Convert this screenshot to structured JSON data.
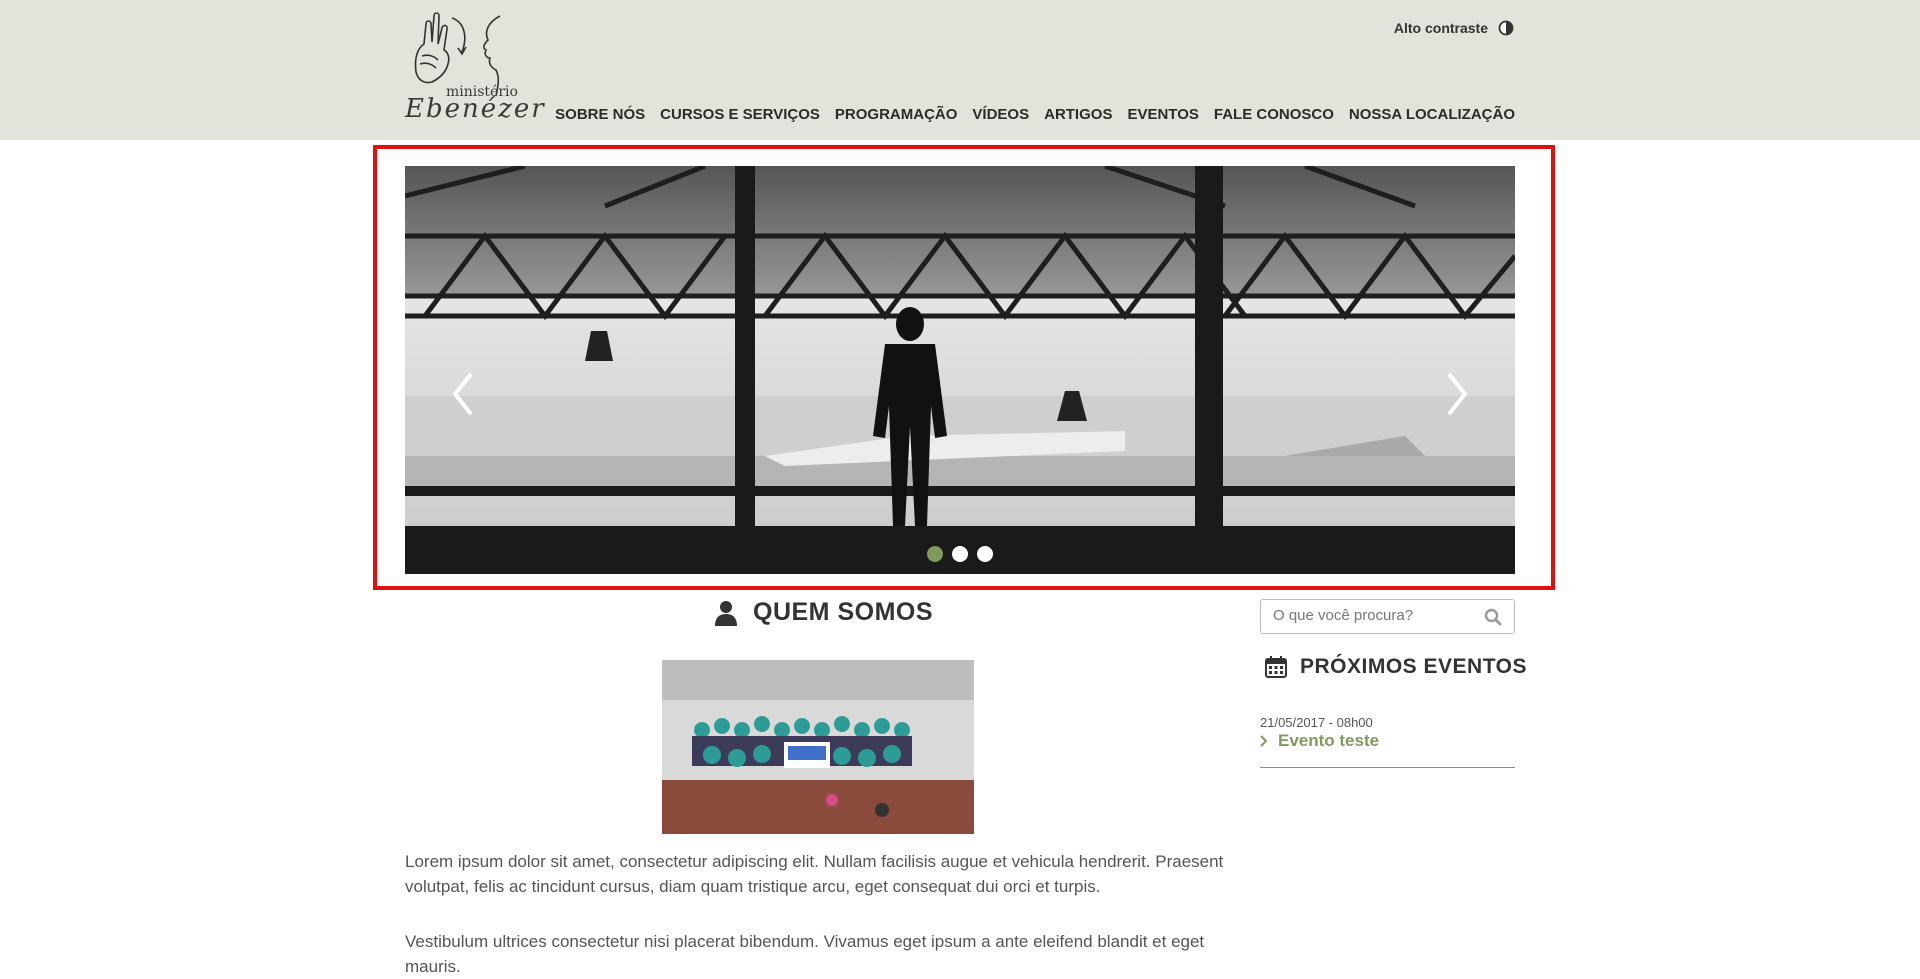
{
  "header": {
    "logo_text_top": "ministério",
    "logo_text_bottom": "Ebenézer",
    "contrast_label": "Alto contraste",
    "nav": [
      "SOBRE NÓS",
      "CURSOS E SERVIÇOS",
      "PROGRAMAÇÃO",
      "VÍDEOS",
      "ARTIGOS",
      "EVENTOS",
      "FALE CONOSCO",
      "NOSSA LOCALIZAÇÃO"
    ]
  },
  "slider": {
    "slide_count": 3,
    "active_slide": 1,
    "prev_icon": "chevron-left-icon",
    "next_icon": "chevron-right-icon"
  },
  "main": {
    "title": "QUEM SOMOS",
    "title_icon": "user-icon",
    "paragraphs": [
      "Lorem ipsum dolor sit amet, consectetur adipiscing elit. Nullam facilisis augue et vehicula hendrerit. Praesent volutpat, felis ac tincidunt cursus, diam quam tristique arcu, eget consequat dui orci et turpis.",
      "Vestibulum ultrices consectetur nisi placerat bibendum. Vivamus eget ipsum a ante eleifend blandit et eget mauris."
    ]
  },
  "sidebar": {
    "search_placeholder": "O que você procura?",
    "events_title": "PRÓXIMOS EVENTOS",
    "events_icon": "calendar-icon",
    "events": [
      {
        "date": "21/05/2017 - 08h00",
        "title": "Evento teste"
      }
    ]
  },
  "colors": {
    "header_bg": "#e3e3dc",
    "accent_green": "#7f9a5c",
    "highlight_red": "#e01010"
  }
}
